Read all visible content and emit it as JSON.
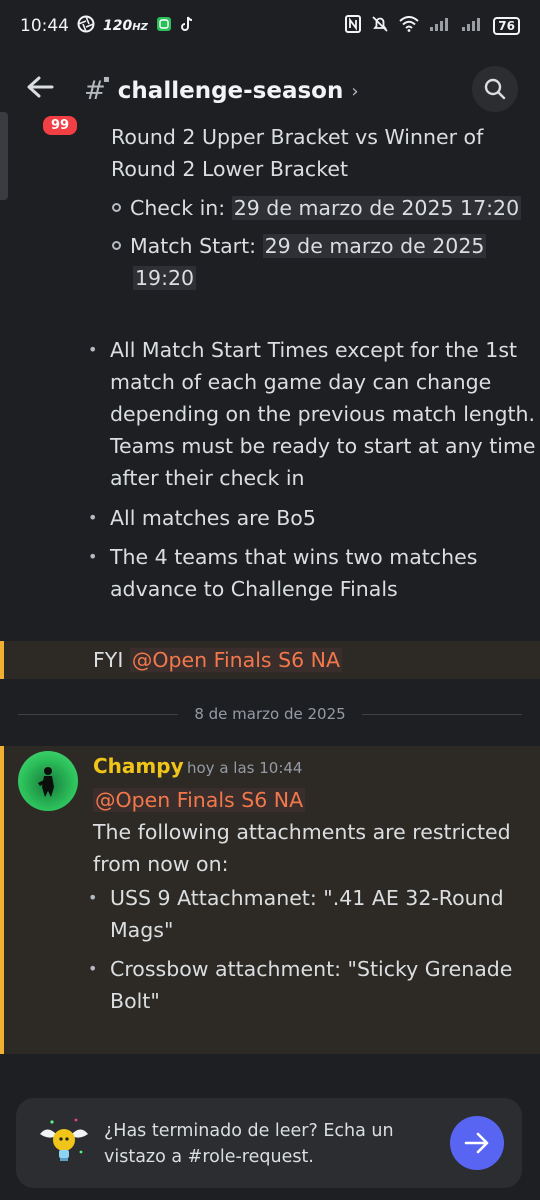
{
  "status_bar": {
    "time": "10:44",
    "refresh_rate": "120",
    "refresh_unit": "HZ",
    "battery": "76"
  },
  "header": {
    "unread_badge": "99",
    "channel_name": "challenge-season"
  },
  "message_continued": {
    "text_lines": [
      "Round 2 Upper Bracket vs Winner of",
      "Round 2 Lower Bracket"
    ],
    "sub_items": [
      {
        "label": "Check in: ",
        "value": "29 de marzo de 2025 17:20"
      },
      {
        "label": "Match Start: ",
        "value_line1": "29 de marzo de 2025",
        "value_line2": "19:20"
      }
    ],
    "bullets": [
      {
        "lines": [
          "All Match Start Times except for the 1st",
          "match of each game day can change",
          "depending on the previous match length.",
          "Teams must be ready to start at any time",
          "after their check in"
        ]
      },
      {
        "lines": [
          "All matches are Bo5"
        ]
      },
      {
        "lines": [
          "The 4 teams that wins two matches",
          "advance to Challenge Finals"
        ]
      }
    ]
  },
  "fyi_message": {
    "prefix": "FYI ",
    "mention": "@Open Finals S6 NA"
  },
  "date_divider": "8 de marzo de 2025",
  "new_message": {
    "author": "Champy",
    "timestamp": "hoy a las 10:44",
    "mention": "@Open Finals S6 NA",
    "text_lines": [
      "The following attachments are restricted",
      "from now on:"
    ],
    "bullets": [
      {
        "lines": [
          "USS 9 Attachmanet: \".41 AE 32-Round",
          "Mags\""
        ]
      },
      {
        "lines": [
          "Crossbow attachment: \"Sticky Grenade",
          "Bolt\""
        ]
      }
    ]
  },
  "prompt": {
    "text_line1": "¿Has terminado de leer? Echa un",
    "text_line2": "vistazo a #role-request."
  },
  "colors": {
    "background": "#1e1f23",
    "mention": "#f2784b",
    "highlight_bar": "#f0b132",
    "author": "#f0c419",
    "accent": "#5865f2",
    "badge": "#f23f43"
  }
}
